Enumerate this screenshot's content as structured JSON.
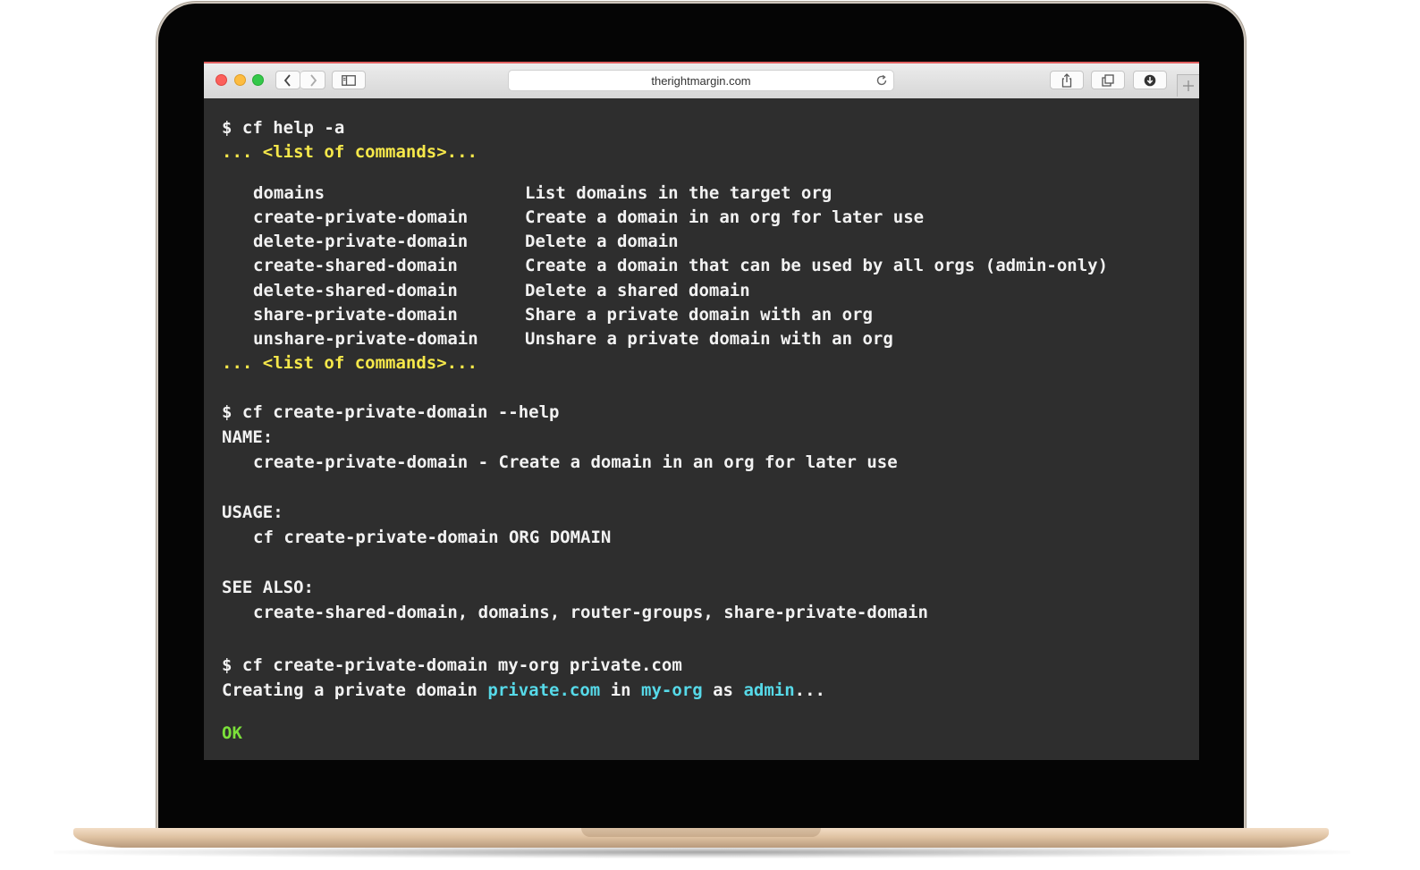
{
  "browser": {
    "url": "therightmargin.com",
    "toolbar": {
      "back_icon": "chevron-left-icon",
      "forward_icon": "chevron-right-icon",
      "sidebar_icon": "sidebar-icon",
      "reload_icon": "reload-icon",
      "share_icon": "share-icon",
      "tabs_icon": "tabs-icon",
      "download_icon": "download-icon",
      "newtab_icon": "plus-icon"
    }
  },
  "terminal": {
    "cmd1": "$ cf help -a",
    "list_marker_top": "... <list of commands>...",
    "commands": [
      {
        "name": "domains",
        "desc": "List domains in the target org"
      },
      {
        "name": "create-private-domain",
        "desc": "Create a domain in an org for later use"
      },
      {
        "name": "delete-private-domain",
        "desc": "Delete a domain"
      },
      {
        "name": "create-shared-domain",
        "desc": "Create a domain that can be used by all orgs (admin-only)"
      },
      {
        "name": "delete-shared-domain",
        "desc": "Delete a shared domain"
      },
      {
        "name": "share-private-domain",
        "desc": "Share a private domain with an org"
      },
      {
        "name": "unshare-private-domain",
        "desc": "Unshare a private domain with an org"
      }
    ],
    "list_marker_bottom": "... <list of commands>...",
    "cmd2": "$ cf create-private-domain --help",
    "name_heading": "NAME:",
    "name_text": "create-private-domain - Create a domain in an org for later use",
    "usage_heading": "USAGE:",
    "usage_text": "cf create-private-domain ORG DOMAIN",
    "see_also_heading": "SEE ALSO:",
    "see_also_text": "create-shared-domain, domains, router-groups, share-private-domain",
    "cmd3": "$ cf create-private-domain my-org private.com",
    "creating": {
      "prefix": "Creating a private domain ",
      "domain": "private.com",
      "in": " in ",
      "org": "my-org",
      "as": " as ",
      "user": "admin",
      "suffix": "..."
    },
    "ok": "OK"
  },
  "colors": {
    "terminal_bg": "#2e2e2e",
    "text": "#f2f2f2",
    "yellow": "#f6e84a",
    "cyan": "#56d9e8",
    "green": "#7be03a"
  }
}
